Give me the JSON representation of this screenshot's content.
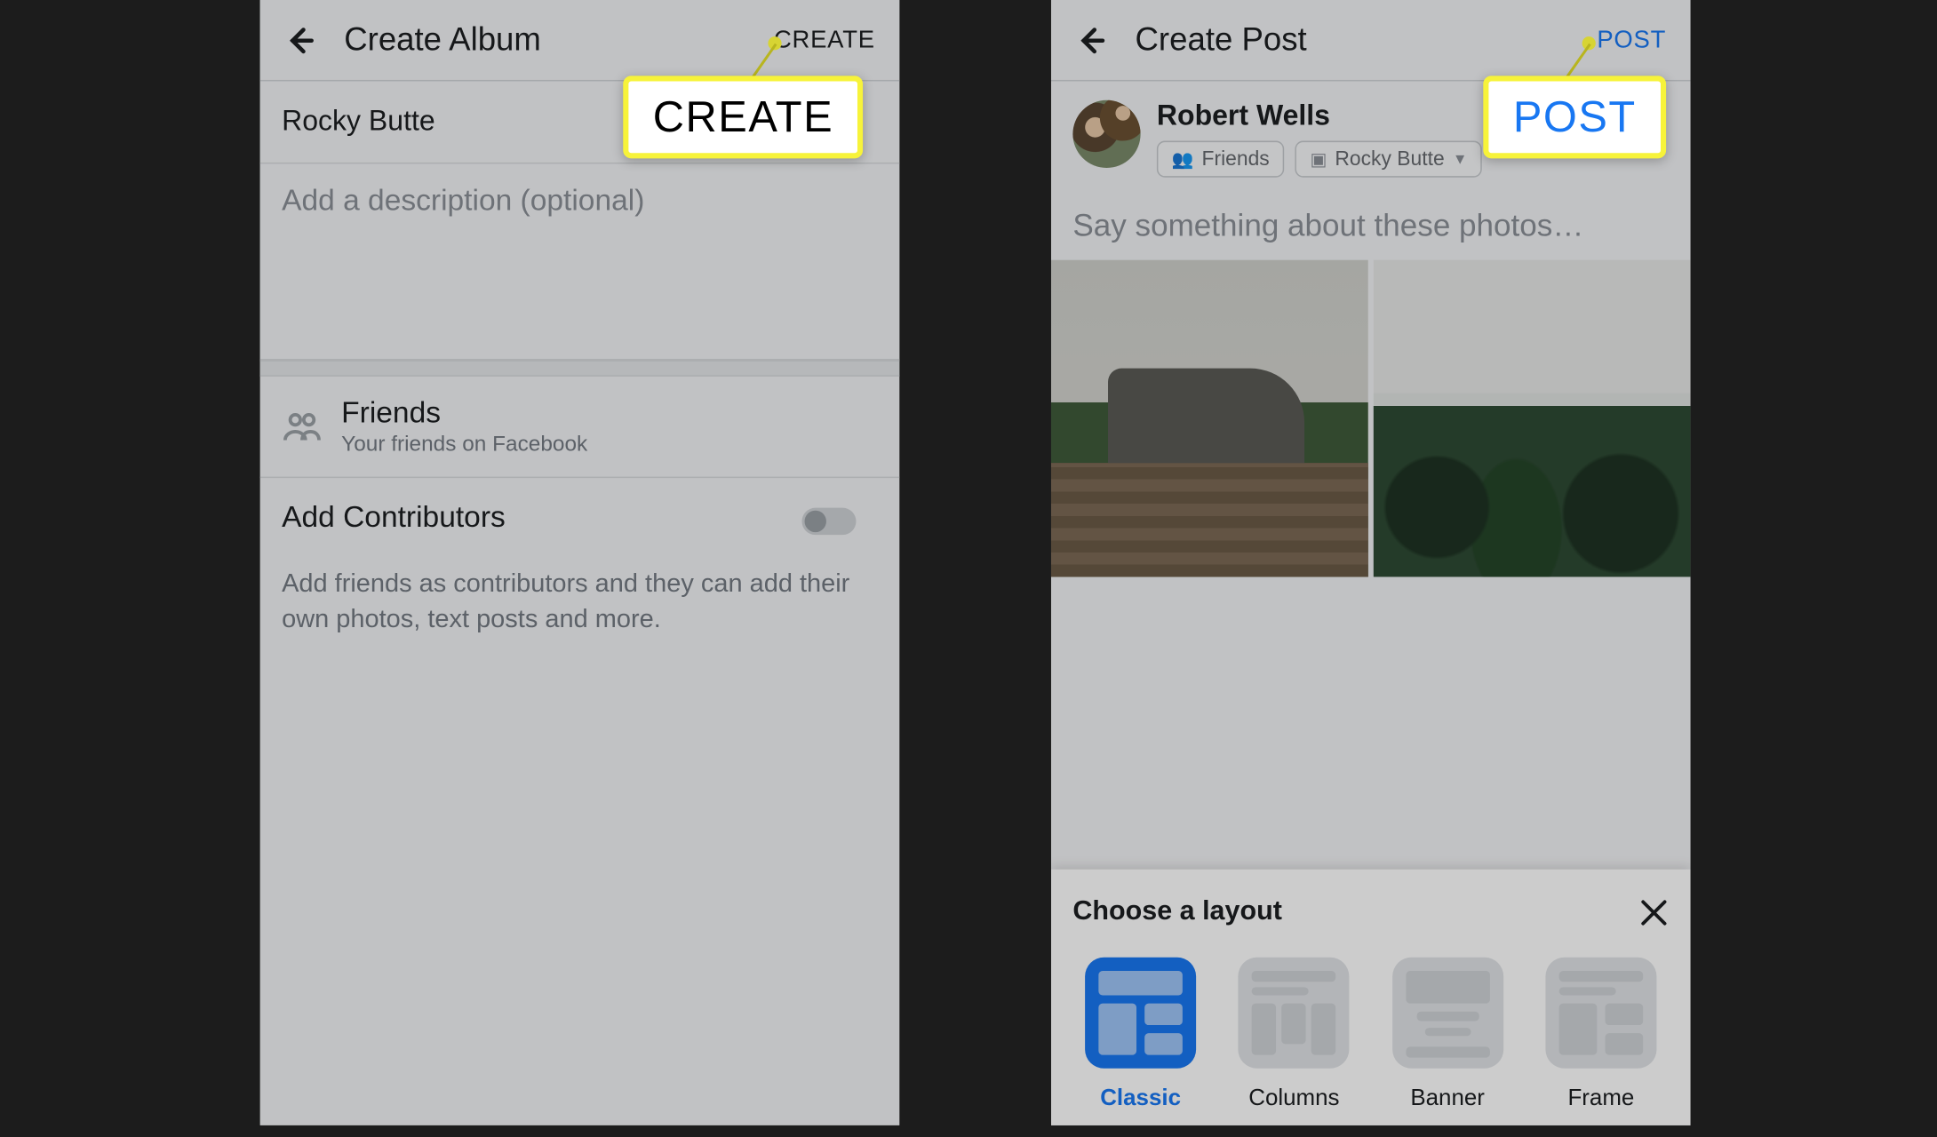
{
  "album": {
    "header": {
      "title": "Create Album",
      "action": "CREATE"
    },
    "name": "Rocky Butte",
    "description_placeholder": "Add a description (optional)",
    "privacy": {
      "label": "Friends",
      "subtitle": "Your friends on Facebook"
    },
    "contributors": {
      "label": "Add Contributors",
      "enabled": false,
      "description": "Add friends as contributors and they can add their own photos, text posts and more."
    }
  },
  "post": {
    "header": {
      "title": "Create Post",
      "action": "POST"
    },
    "user": "Robert Wells",
    "chips": [
      "Friends",
      "Rocky Butte"
    ],
    "caption_placeholder": "Say something about these photos…",
    "sheet": {
      "title": "Choose a layout",
      "layouts": [
        "Classic",
        "Columns",
        "Banner",
        "Frame"
      ],
      "selected": "Classic"
    }
  },
  "callouts": {
    "create": "CREATE",
    "post": "POST"
  },
  "colors": {
    "accent_blue": "#1877f2",
    "highlight_yellow": "#f7f33a"
  }
}
